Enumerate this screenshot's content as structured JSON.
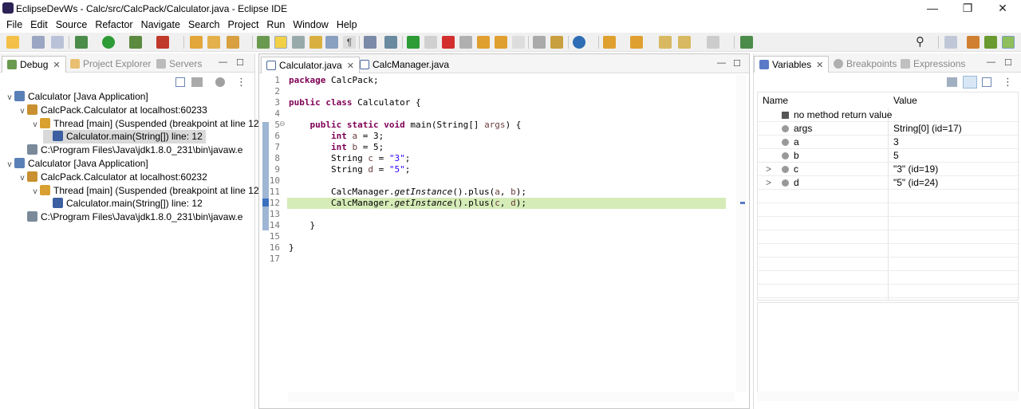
{
  "window": {
    "title": "EclipseDevWs - Calc/src/CalcPack/Calculator.java - Eclipse IDE",
    "minimize": "—",
    "restore": "❐",
    "close": "✕"
  },
  "menu": [
    "File",
    "Edit",
    "Source",
    "Refactor",
    "Navigate",
    "Search",
    "Project",
    "Run",
    "Window",
    "Help"
  ],
  "debug_panel": {
    "tabs": [
      {
        "label": "Debug",
        "active": true
      },
      {
        "label": "Project Explorer"
      },
      {
        "label": "Servers"
      }
    ],
    "tree": [
      {
        "label": "Calculator [Java Application]",
        "indent": 0,
        "twisty": "v",
        "icon": "java-app-icon"
      },
      {
        "label": "CalcPack.Calculator at localhost:60233",
        "indent": 1,
        "twisty": "v",
        "icon": "debug-target-icon"
      },
      {
        "label": "Thread [main] (Suspended (breakpoint at line 12",
        "indent": 2,
        "twisty": "v",
        "icon": "thread-suspended-icon"
      },
      {
        "label": "Calculator.main(String[]) line: 12",
        "indent": 3,
        "twisty": "",
        "icon": "stack-frame-icon",
        "selected": true
      },
      {
        "label": "C:\\Program Files\\Java\\jdk1.8.0_231\\bin\\javaw.e",
        "indent": 1,
        "twisty": "",
        "icon": "process-icon"
      },
      {
        "label": "Calculator [Java Application]",
        "indent": 0,
        "twisty": "v",
        "icon": "java-app-icon"
      },
      {
        "label": "CalcPack.Calculator at localhost:60232",
        "indent": 1,
        "twisty": "v",
        "icon": "debug-target-icon"
      },
      {
        "label": "Thread [main] (Suspended (breakpoint at line 12",
        "indent": 2,
        "twisty": "v",
        "icon": "thread-suspended-icon"
      },
      {
        "label": "Calculator.main(String[]) line: 12",
        "indent": 3,
        "twisty": "",
        "icon": "stack-frame-icon"
      },
      {
        "label": "C:\\Program Files\\Java\\jdk1.8.0_231\\bin\\javaw.e",
        "indent": 1,
        "twisty": "",
        "icon": "process-icon"
      }
    ]
  },
  "editor": {
    "tabs": [
      {
        "label": "Calculator.java",
        "active": true
      },
      {
        "label": "CalcManager.java"
      }
    ],
    "line_numbers": [
      "1",
      "2",
      "3",
      "4",
      "5",
      "6",
      "7",
      "8",
      "9",
      "10",
      "11",
      "12",
      "13",
      "14",
      "15",
      "16",
      "17"
    ],
    "current_line": "12"
  },
  "variables_panel": {
    "tabs": [
      {
        "label": "Variables",
        "active": true
      },
      {
        "label": "Breakpoints"
      },
      {
        "label": "Expressions"
      }
    ],
    "col_name": "Name",
    "col_value": "Value",
    "rows": [
      {
        "name": "no method return value",
        "value": "",
        "expand": ""
      },
      {
        "name": "args",
        "value": "String[0]  (id=17)",
        "expand": ""
      },
      {
        "name": "a",
        "value": "3",
        "expand": ""
      },
      {
        "name": "b",
        "value": "5",
        "expand": ""
      },
      {
        "name": "c",
        "value": "\"3\" (id=19)",
        "expand": ">"
      },
      {
        "name": "d",
        "value": "\"5\" (id=24)",
        "expand": ">"
      }
    ]
  }
}
